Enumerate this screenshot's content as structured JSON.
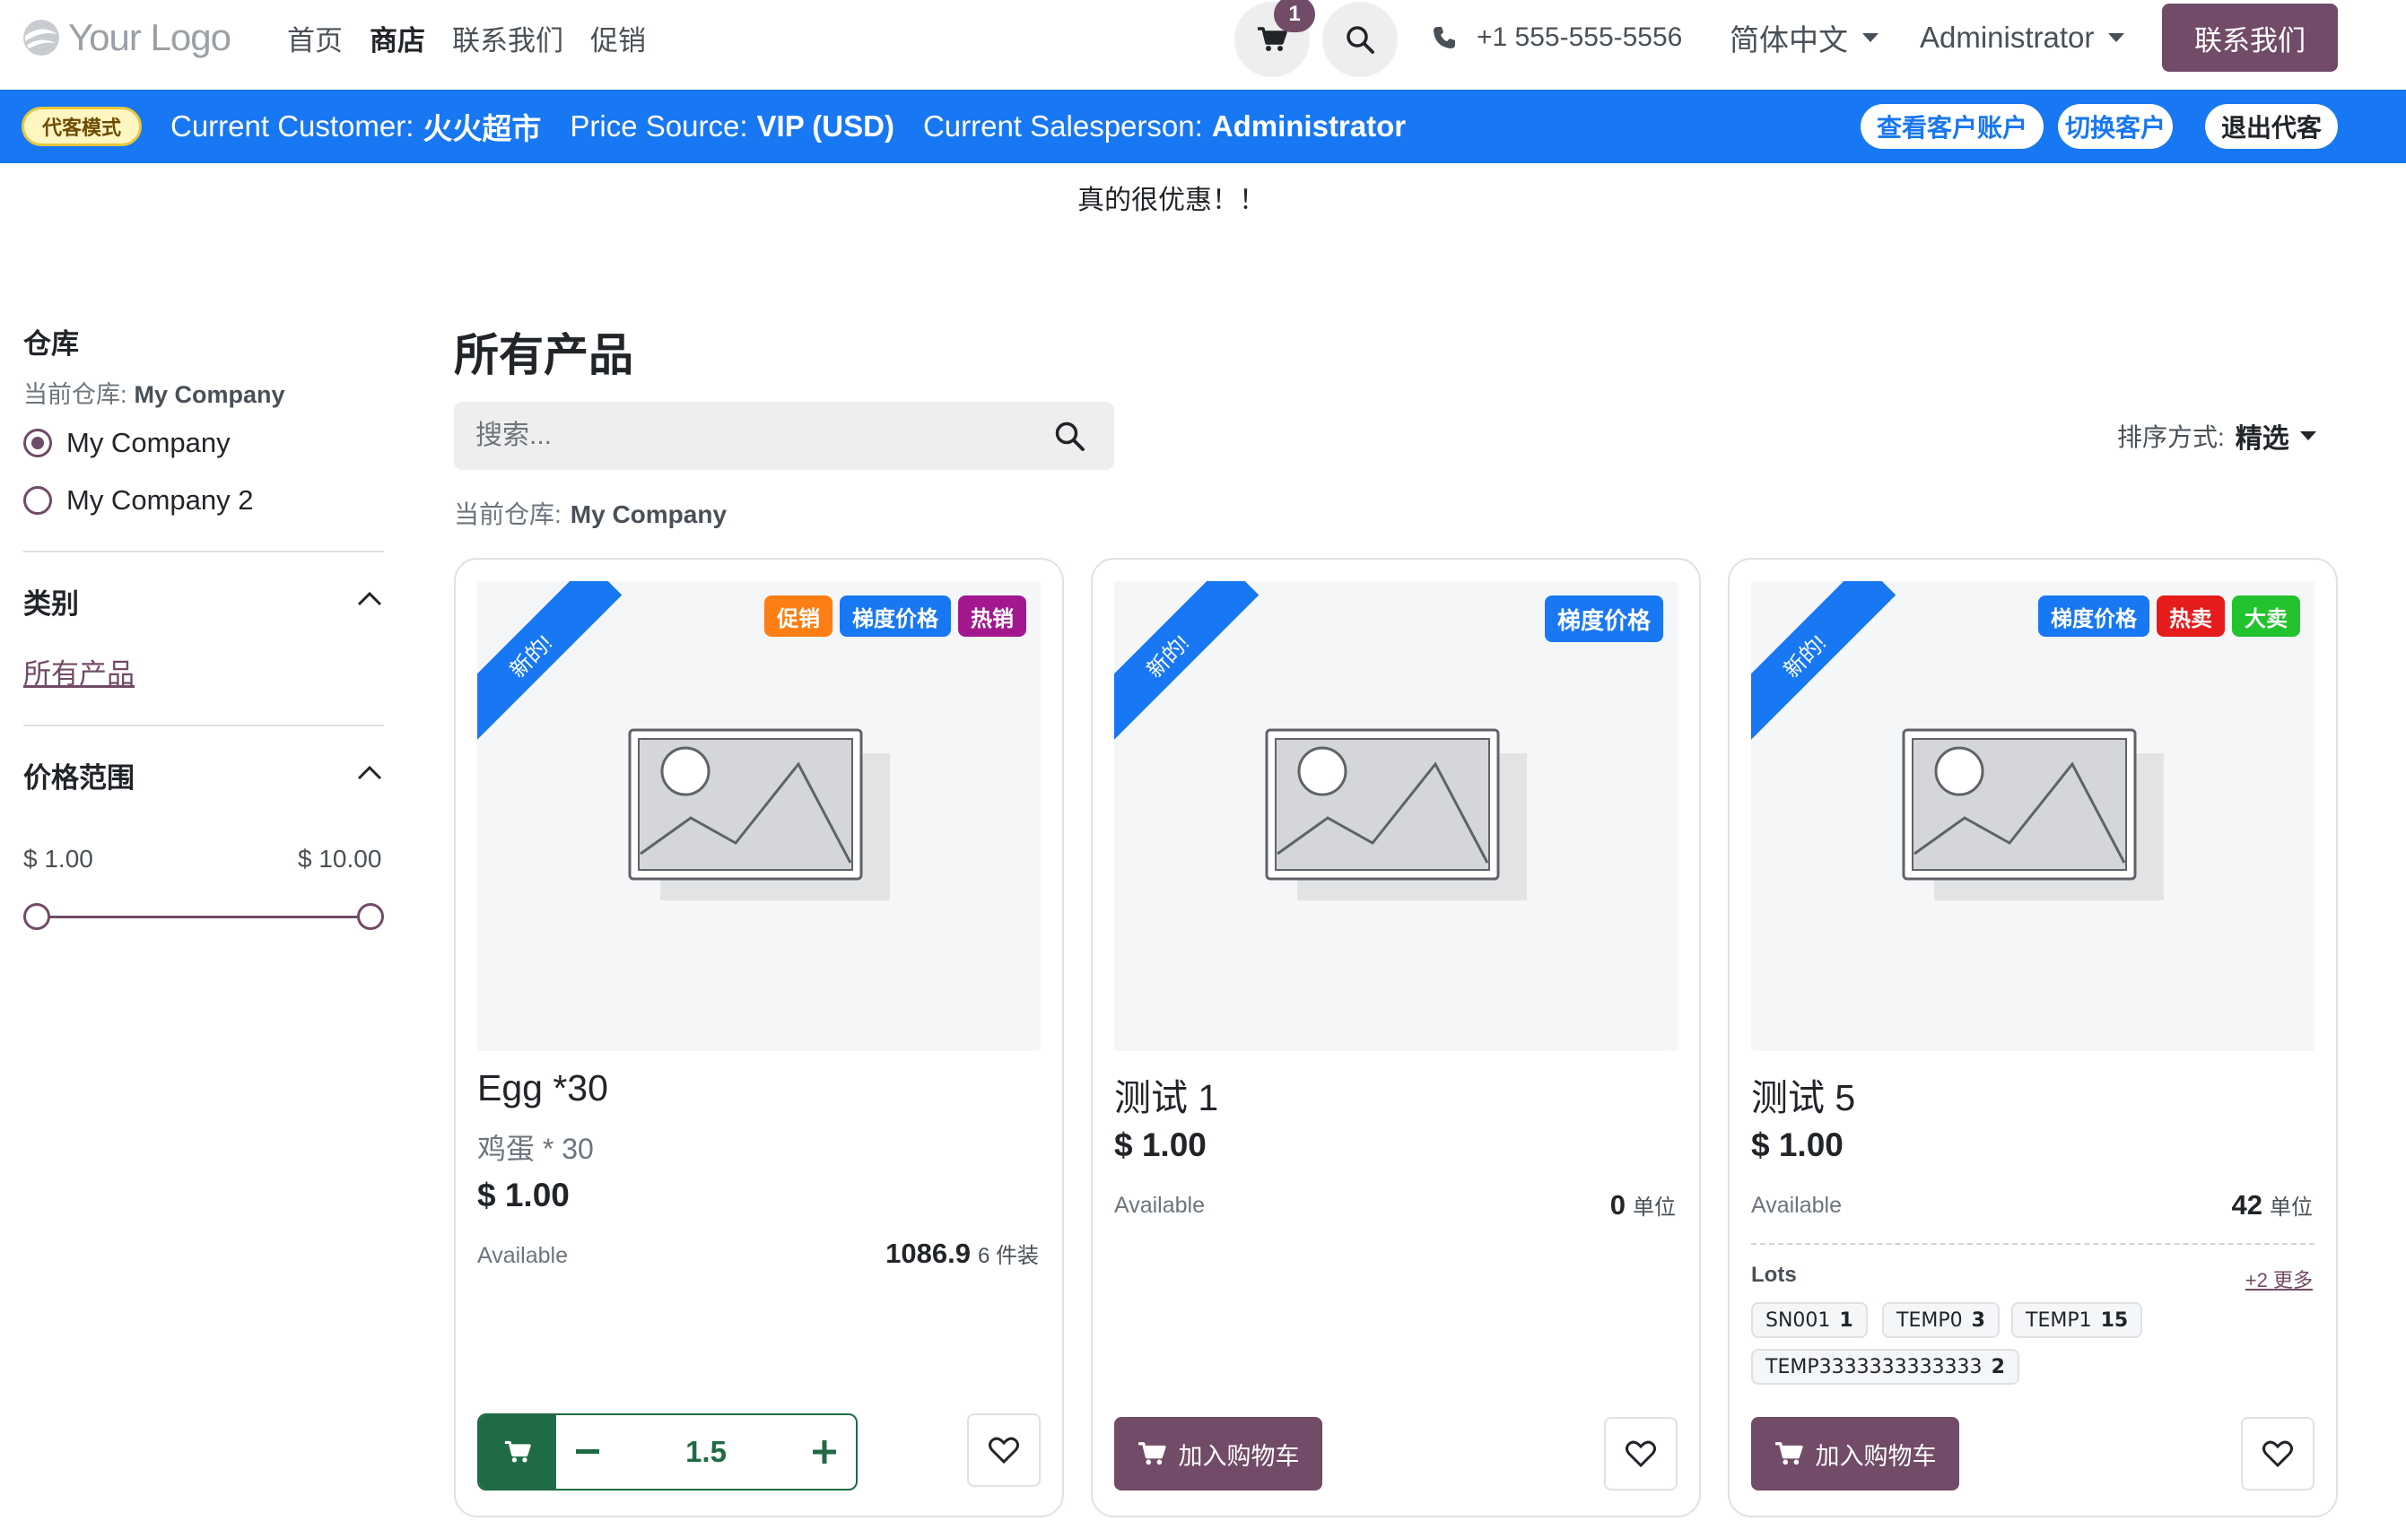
{
  "header": {
    "logo_text": "Your Logo",
    "nav": [
      "首页",
      "商店",
      "联系我们",
      "促销"
    ],
    "cart_count": "1",
    "phone": "+1 555-555-5556",
    "language": "简体中文",
    "user": "Administrator",
    "contact_button": "联系我们"
  },
  "agent_bar": {
    "badge": "代客模式",
    "customer_label": "Current Customer:",
    "customer_value": "火火超市",
    "price_label": "Price Source:",
    "price_value": "VIP (USD)",
    "salesperson_label": "Current Salesperson:",
    "salesperson_value": "Administrator",
    "buttons": [
      "查看客户账户",
      "切换客户",
      "退出代客"
    ]
  },
  "promo_text": "真的很优惠！！",
  "sidebar": {
    "warehouse_title": "仓库",
    "current_label": "当前仓库:",
    "current_value": "My Company",
    "warehouses": [
      {
        "label": "My Company",
        "selected": true
      },
      {
        "label": "My Company 2",
        "selected": false
      }
    ],
    "category_title": "类别",
    "category_link": "所有产品",
    "price_title": "价格范围",
    "price_min": "$ 1.00",
    "price_max": "$ 10.00"
  },
  "main": {
    "title": "所有产品",
    "search_placeholder": "搜索...",
    "sort_label": "排序方式:",
    "sort_value": "精选",
    "current_label": "当前仓库:",
    "current_value": "My Company"
  },
  "products": [
    {
      "ribbon": "新的!",
      "badges": [
        {
          "label": "促销",
          "color": "#fd7e14"
        },
        {
          "label": "梯度价格",
          "color": "#1877f2"
        },
        {
          "label": "热销",
          "color": "#a3188f"
        }
      ],
      "name": "Egg *30",
      "subtitle": "鸡蛋 * 30",
      "price": "$ 1.00",
      "available_label": "Available",
      "qty": "1086.9",
      "unit": "6 件装",
      "cart_qty": "1.5"
    },
    {
      "ribbon": "新的!",
      "badges": [
        {
          "label": "梯度价格",
          "color": "#1877f2"
        }
      ],
      "name": "测试 1",
      "price": "$ 1.00",
      "available_label": "Available",
      "qty": "0",
      "unit": "单位",
      "add_to_cart": "加入购物车"
    },
    {
      "ribbon": "新的!",
      "badges": [
        {
          "label": "梯度价格",
          "color": "#1877f2"
        },
        {
          "label": "热卖",
          "color": "#e61c1c"
        },
        {
          "label": "大卖",
          "color": "#22c32e"
        }
      ],
      "name": "测试 5",
      "price": "$ 1.00",
      "available_label": "Available",
      "qty": "42",
      "unit": "单位",
      "lots_title": "Lots",
      "lots_more": "+2 更多",
      "lots": [
        {
          "code": "SN001",
          "qty": "1"
        },
        {
          "code": "TEMP0",
          "qty": "3"
        },
        {
          "code": "TEMP1",
          "qty": "15"
        },
        {
          "code": "TEMP3333333333333",
          "qty": "2"
        }
      ],
      "add_to_cart": "加入购物车"
    }
  ]
}
